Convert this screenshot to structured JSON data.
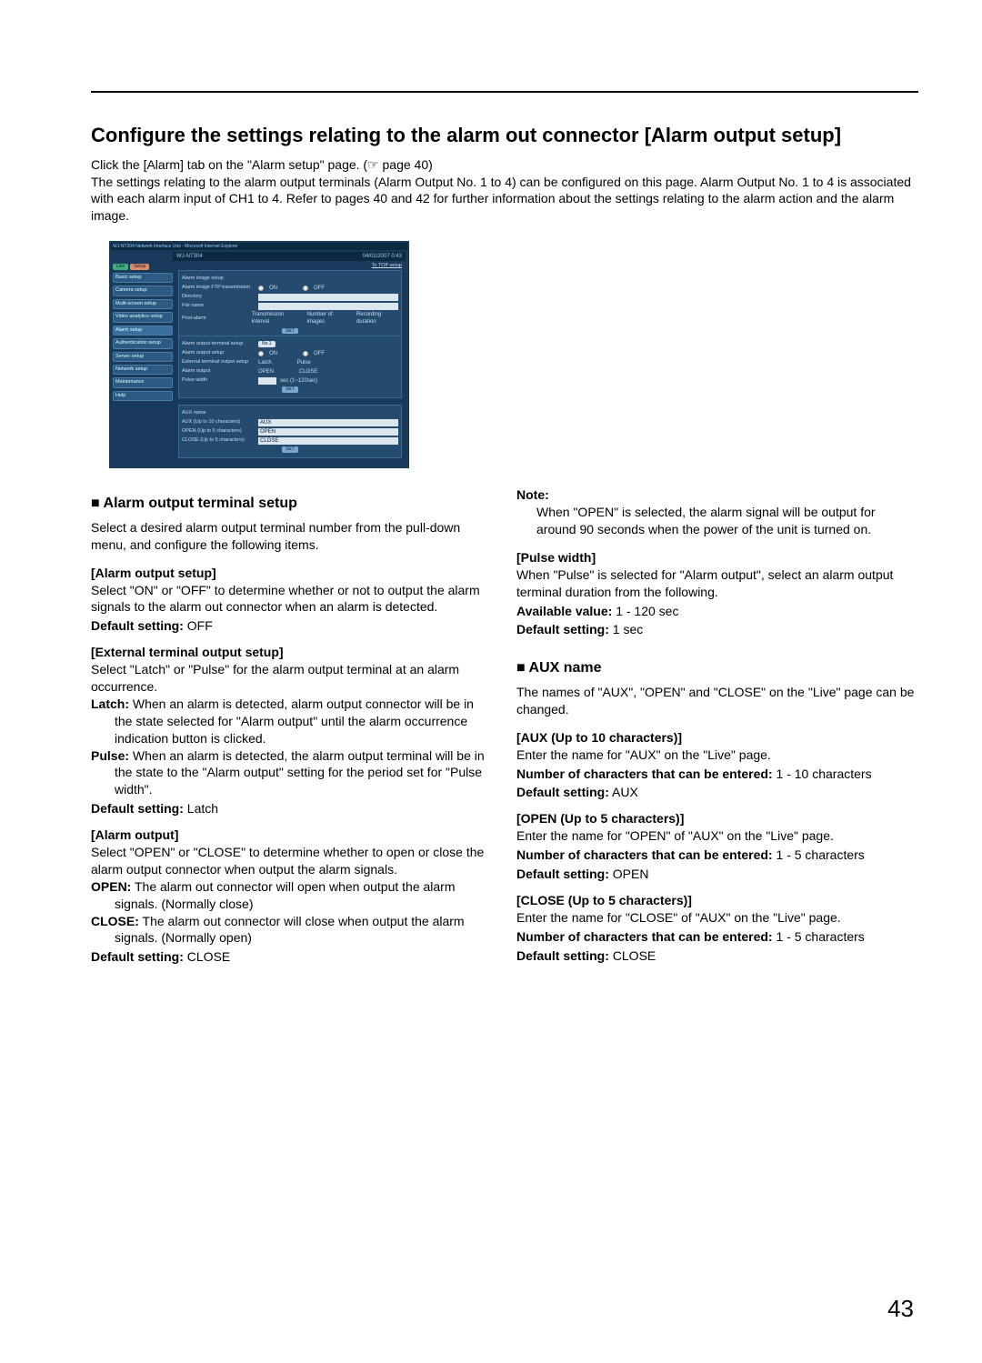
{
  "title": "Configure the settings relating to the alarm out connector [Alarm output setup]",
  "intro_line1": "Click the [Alarm] tab on the \"Alarm setup\" page. (☞ page 40)",
  "intro_body": "The settings relating to the alarm output terminals (Alarm Output No. 1 to 4) can be configured on this page. Alarm Output No. 1 to 4 is associated with each alarm input of CH1 to 4. Refer to pages 40 and 42 for further information about the settings relating to the alarm action and the alarm image.",
  "screenshot": {
    "window_title": "WJ-NT304 Network Interface Unit - Microsoft Internet Explorer",
    "model": "WJ-NT304",
    "date": "04/01/2007  0:43",
    "topright": "To TOP setup",
    "tabs": {
      "live": "Live",
      "setup": "Setup"
    },
    "sidebar": [
      "Basic setup",
      "Camera setup",
      "Multi-screen setup",
      "Video analytics setup",
      "Alarm setup",
      "Authentication setup",
      "Server setup",
      "Network setup",
      "Maintenance",
      "Help"
    ],
    "panel1": {
      "title": "Alarm image setup",
      "r1": "Alarm image FTP transmission",
      "on": "ON",
      "off": "OFF",
      "r2": "Directory",
      "r3": "File name",
      "r4": "Post-alarm",
      "c1": "Transmission interval",
      "c2": "Number of images",
      "c3": "Recording duration",
      "set": "SET"
    },
    "panel2": {
      "title": "Alarm output terminal setup",
      "sel": "No.1",
      "r1": "Alarm output setup",
      "on": "ON",
      "off": "OFF",
      "r2": "External terminal output setup",
      "latch": "Latch",
      "pulse": "Pulse",
      "r3": "Alarm output",
      "open": "OPEN",
      "close": "CLOSE",
      "r4": "Pulse width",
      "unit": "sec (1~120sec)",
      "set": "SET"
    },
    "panel3": {
      "title": "AUX name",
      "r1": "AUX (Up to 10 characters)",
      "v1": "AUX",
      "r2": "OPEN (Up to 5 characters)",
      "v2": "OPEN",
      "r3": "CLOSE (Up to 5 characters)",
      "v3": "CLOSE",
      "set": "SET"
    }
  },
  "left": {
    "h_terminal": "Alarm output terminal setup",
    "terminal_lead": "Select a desired alarm output terminal number from the pull-down menu, and configure the following items.",
    "h_alarm_output_setup": "[Alarm output setup]",
    "alarm_output_setup": "Select \"ON\" or \"OFF\" to determine whether or not to output the alarm signals to the alarm out connector when an alarm is detected.",
    "alarm_output_setup_def_k": "Default setting:",
    "alarm_output_setup_def_v": " OFF",
    "h_ext": "[External terminal output setup]",
    "ext_lead": "Select \"Latch\" or \"Pulse\" for the alarm output terminal at an alarm occurrence.",
    "ext_latch": "Latch: When an alarm is detected, alarm output connector will be in the state selected for \"Alarm output\" until the alarm occurrence indication button is clicked.",
    "ext_pulse": "Pulse: When an alarm is detected, the alarm output terminal will be in the state to the \"Alarm output\" setting for the period set for \"Pulse width\".",
    "ext_def_k": "Default setting:",
    "ext_def_v": " Latch",
    "h_alarm_output": "[Alarm output]",
    "alarm_output_lead": "Select \"OPEN\" or \"CLOSE\" to determine whether to open or close the alarm output connector when output the alarm signals.",
    "alarm_output_open": "OPEN: The alarm out connector will open when output the alarm signals. (Normally close)",
    "alarm_output_close": "CLOSE: The alarm out connector will close when output the alarm signals. (Normally open)",
    "alarm_output_def_k": "Default setting:",
    "alarm_output_def_v": " CLOSE"
  },
  "right": {
    "note_title": "Note:",
    "note_body": "When \"OPEN\" is selected, the alarm signal will be output for around 90 seconds when the power of the unit is turned on.",
    "h_pulse": "[Pulse width]",
    "pulse_lead": "When \"Pulse\" is selected for \"Alarm output\", select an alarm output terminal duration from the following.",
    "pulse_avail_k": "Available value:",
    "pulse_avail_v": " 1 - 120 sec",
    "pulse_def_k": "Default setting:",
    "pulse_def_v": " 1 sec",
    "h_aux": "AUX name",
    "aux_lead": "The names of \"AUX\", \"OPEN\" and \"CLOSE\" on the \"Live\" page can be changed.",
    "h_aux10": "[AUX (Up to 10 characters)]",
    "aux10_lead": "Enter the name for \"AUX\" on the \"Live\" page.",
    "aux10_num_k": "Number of characters that can be entered:",
    "aux10_num_v": " 1 - 10 characters",
    "aux10_def_k": "Default setting:",
    "aux10_def_v": " AUX",
    "h_open5": "[OPEN (Up to 5 characters)]",
    "open5_lead": "Enter the name for \"OPEN\" of \"AUX\" on the \"Live\" page.",
    "open5_num_k": "Number of characters that can be entered:",
    "open5_num_v": " 1 - 5 characters",
    "open5_def_k": "Default setting:",
    "open5_def_v": " OPEN",
    "h_close5": "[CLOSE (Up to 5 characters)]",
    "close5_lead": "Enter the name for \"CLOSE\" of \"AUX\" on the \"Live\" page.",
    "close5_num_k": "Number of characters that can be entered:",
    "close5_num_v": " 1 - 5 characters",
    "close5_def_k": "Default setting:",
    "close5_def_v": " CLOSE"
  },
  "pagenum": "43"
}
